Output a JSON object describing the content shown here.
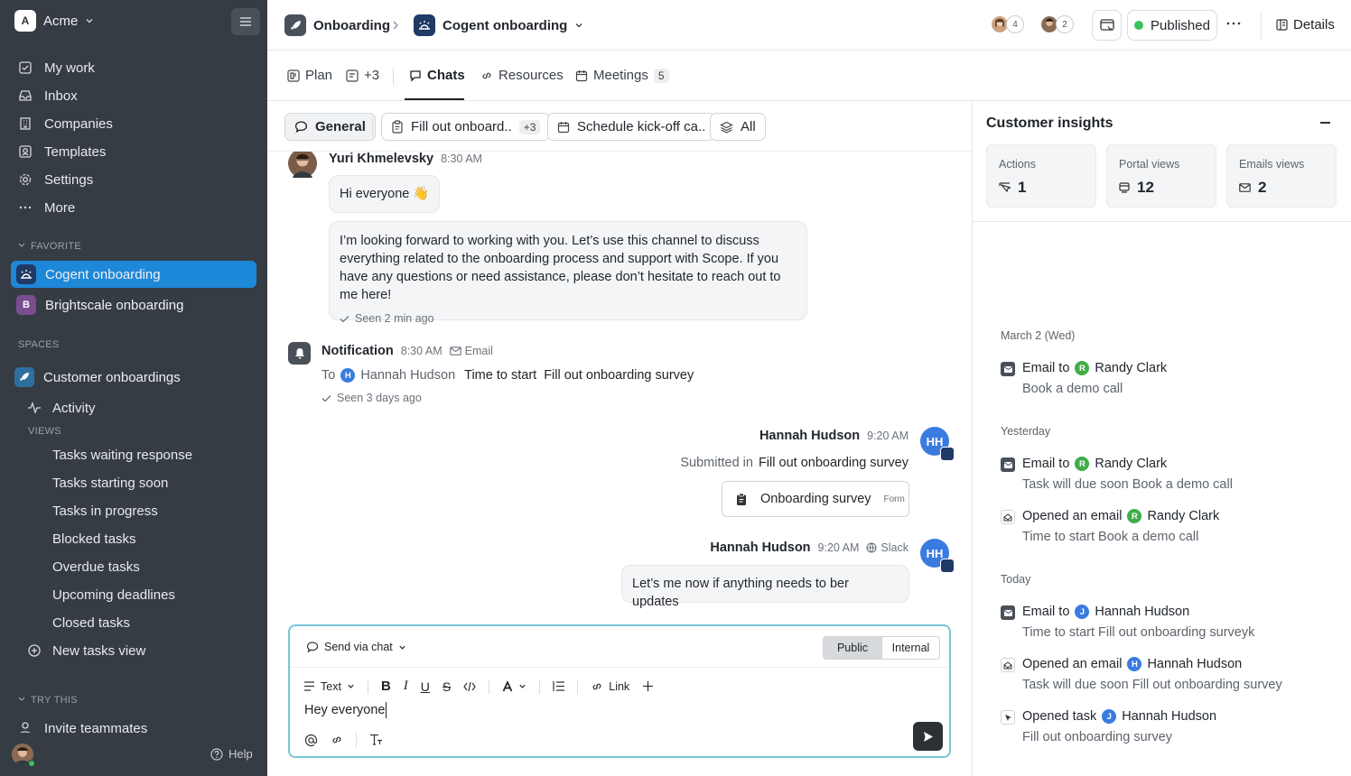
{
  "workspace": {
    "initial": "A",
    "name": "Acme"
  },
  "nav": [
    {
      "label": "My work",
      "icon": "check-square-icon"
    },
    {
      "label": "Inbox",
      "icon": "inbox-icon"
    },
    {
      "label": "Companies",
      "icon": "building-icon"
    },
    {
      "label": "Templates",
      "icon": "template-icon"
    },
    {
      "label": "Settings",
      "icon": "gear-icon"
    },
    {
      "label": "More",
      "icon": "more-icon"
    }
  ],
  "favorite_label": "FAVORITE",
  "favorites": [
    {
      "label": "Cogent onboarding",
      "initial": ""
    },
    {
      "label": "Brightscale onboarding",
      "initial": "B"
    }
  ],
  "spaces_label": "SPACES",
  "space": {
    "label": "Customer onboardings"
  },
  "activity_label": "Activity",
  "views_label": "VIEWS",
  "views": [
    "Tasks waiting response",
    "Tasks starting soon",
    "Tasks in progress",
    "Blocked tasks",
    "Overdue tasks",
    "Upcoming deadlines",
    "Closed tasks"
  ],
  "new_view_label": "New tasks view",
  "try_label": "TRY THIS",
  "invite_label": "Invite teammates",
  "help_label": "Help",
  "header": {
    "crumb1": "Onboarding",
    "crumb2": "Cogent onboarding",
    "avatar_count1": "4",
    "avatar_count2": "2",
    "status": "Published",
    "status_color": "#3fbf5f",
    "details": "Details"
  },
  "tabs": {
    "plan": "Plan",
    "plus": "+3",
    "chats": "Chats",
    "resources": "Resources",
    "meetings": "Meetings",
    "meetings_count": "5"
  },
  "filters": {
    "general": "General",
    "survey": "Fill out onboard..",
    "survey_count": "+3",
    "kickoff": "Schedule kick-off ca..",
    "all": "All"
  },
  "messages": {
    "m1": {
      "name": "Yuri Khmelevsky",
      "time": "8:30 AM",
      "bubble1": "Hi everyone 👋",
      "bubble2": "I’m looking forward to working with you. Let’s use this channel to discuss everything related to the onboarding process and support with Scope. If you have any questions or need assistance, please don’t hesitate to reach out to me here!",
      "seen": "Seen 2 min ago"
    },
    "notif": {
      "title": "Notification",
      "time": "8:30 AM",
      "channel": "Email",
      "to": "To",
      "avatar": "H",
      "person": "Hannah Hudson",
      "text1": "Time to start",
      "text2": "Fill out onboarding survey",
      "seen": "Seen 3 days ago"
    },
    "m2": {
      "name": "Hannah Hudson",
      "time": "9:20 AM",
      "submitted": "Submitted in",
      "task": "Fill out onboarding survey",
      "card_title": "Onboarding survey",
      "card_tag": "Form",
      "initials": "HH"
    },
    "m3": {
      "name": "Hannah Hudson",
      "time": "9:20 AM",
      "channel": "Slack",
      "text": "Let’s me now if anything needs to ber updates",
      "initials": "HH"
    }
  },
  "composer": {
    "send_via": "Send via chat",
    "public": "Public",
    "internal": "Internal",
    "text_style": "Text",
    "link": "Link",
    "value": "Hey everyone"
  },
  "insights": {
    "title": "Customer insights",
    "stats": [
      {
        "label": "Actions",
        "value": "1"
      },
      {
        "label": "Portal views",
        "value": "12"
      },
      {
        "label": "Emails views",
        "value": "2"
      }
    ],
    "groups": [
      {
        "day": "March 2 (Wed)",
        "events": [
          {
            "title": "Email to",
            "avatar": "R",
            "avatar_color": "#3fae49",
            "person": "Randy Clark",
            "sub": "Book a demo call",
            "icon": "email-icon"
          }
        ]
      },
      {
        "day": "Yesterday",
        "events": [
          {
            "title": "Email to",
            "avatar": "R",
            "avatar_color": "#3fae49",
            "person": "Randy Clark",
            "sub": "Task will due soon  Book a demo call",
            "icon": "email-icon"
          },
          {
            "title": "Opened an email",
            "avatar": "R",
            "avatar_color": "#3fae49",
            "person": "Randy Clark",
            "sub": "Time to start  Book a demo call",
            "icon": "opened-email-icon"
          }
        ]
      },
      {
        "day": "Today",
        "events": [
          {
            "title": "Email to",
            "avatar": "J",
            "avatar_color": "#3a7be0",
            "person": "Hannah Hudson",
            "sub": "Time to start  Fill out onboarding surveyk",
            "icon": "email-icon"
          },
          {
            "title": "Opened an email",
            "avatar": "H",
            "avatar_color": "#3a7be0",
            "person": "Hannah Hudson",
            "sub": "Task will due soon  Fill out onboarding survey",
            "icon": "opened-email-icon"
          },
          {
            "title": "Opened task",
            "avatar": "J",
            "avatar_color": "#3a7be0",
            "person": "Hannah Hudson",
            "sub": "Fill out onboarding survey",
            "icon": "cursor-icon"
          }
        ]
      }
    ]
  }
}
